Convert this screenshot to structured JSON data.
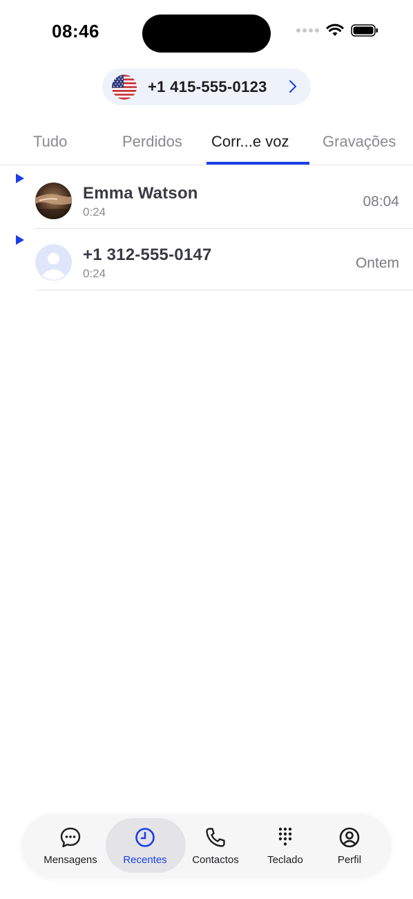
{
  "status_bar": {
    "time": "08:46"
  },
  "account": {
    "number": "+1 415-555-0123"
  },
  "tabs": [
    {
      "label": "Tudo"
    },
    {
      "label": "Perdidos"
    },
    {
      "label": "Corr...e voz"
    },
    {
      "label": "Gravações"
    }
  ],
  "voicemails": [
    {
      "name": "Emma Watson",
      "duration": "0:24",
      "time": "08:04"
    },
    {
      "name": "+1 312-555-0147",
      "duration": "0:24",
      "time": "Ontem"
    }
  ],
  "bottom_nav": [
    {
      "label": "Mensagens",
      "icon": "chat-bubble-icon"
    },
    {
      "label": "Recentes",
      "icon": "clock-icon"
    },
    {
      "label": "Contactos",
      "icon": "phone-icon"
    },
    {
      "label": "Teclado",
      "icon": "keypad-icon"
    },
    {
      "label": "Perfil",
      "icon": "profile-icon"
    }
  ],
  "colors": {
    "accent": "#1a3de8",
    "pill_bg": "#eef2fb"
  }
}
